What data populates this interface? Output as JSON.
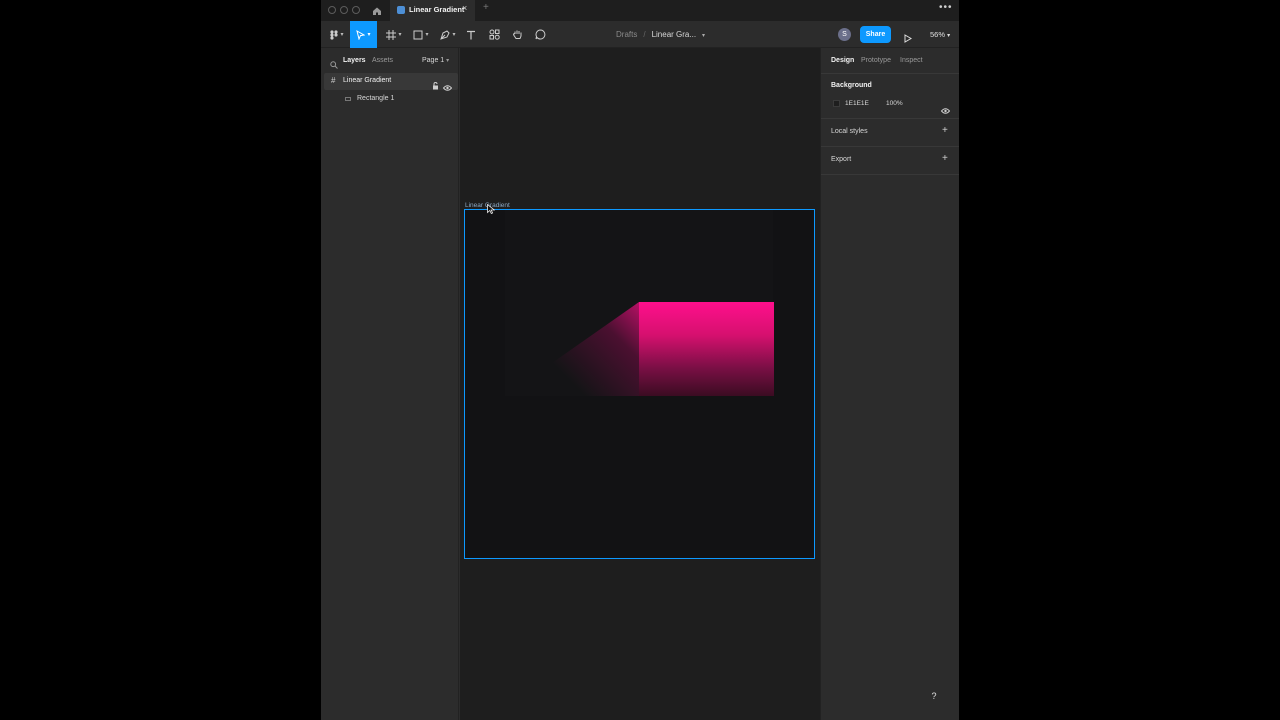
{
  "window": {
    "tab_title": "Linear Gradient",
    "tab_close_glyph": "×",
    "new_tab_glyph": "+",
    "more_glyph": "•••"
  },
  "toolbar": {
    "breadcrumb_root": "Drafts",
    "breadcrumb_separator": "/",
    "file_name": "Linear Gra...",
    "avatar_initial": "S",
    "share_label": "Share",
    "zoom_label": "56%",
    "accent_color": "#0d99ff"
  },
  "left_panel": {
    "tabs": {
      "layers": "Layers",
      "assets": "Assets",
      "page": "Page 1"
    },
    "layers": [
      {
        "label": "Linear Gradient",
        "type": "frame",
        "selected": true
      },
      {
        "label": "Rectangle 1",
        "type": "rectangle",
        "selected": false
      }
    ]
  },
  "canvas": {
    "frame_label": "Linear Gradient",
    "background_color": "#1e1e1e",
    "frame_fill": "#121214",
    "gradient_color": "#ff0f8c"
  },
  "right_panel": {
    "tabs": {
      "design": "Design",
      "prototype": "Prototype",
      "inspect": "Inspect"
    },
    "background": {
      "title": "Background",
      "hex": "1E1E1E",
      "opacity": "100%"
    },
    "local_styles": "Local styles",
    "export": "Export",
    "plus_glyph": "+"
  },
  "help": "?",
  "icons": [
    "figma-menu-icon",
    "move-tool-icon",
    "frame-tool-icon",
    "shape-tool-icon",
    "pen-tool-icon",
    "text-tool-icon",
    "resources-icon",
    "hand-tool-icon",
    "comment-icon",
    "search-icon",
    "lock-icon",
    "eye-icon",
    "play-icon",
    "home-icon",
    "cursor-icon"
  ]
}
